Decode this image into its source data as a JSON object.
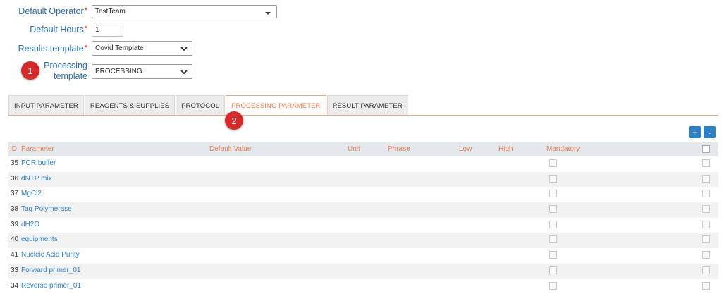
{
  "form": {
    "operator": {
      "label": "Default Operator",
      "value": "TestTeam"
    },
    "hours": {
      "label": "Default Hours",
      "value": "1"
    },
    "results_template": {
      "label": "Results template",
      "value": "Covid Template"
    },
    "processing_template": {
      "label_line1": "Processing",
      "label_line2": "template",
      "value": "PROCESSING"
    },
    "required_mark": "*"
  },
  "badges": {
    "one": "1",
    "two": "2"
  },
  "tabs": [
    {
      "label": "INPUT PARAMETER",
      "active": false
    },
    {
      "label": "REAGENTS & SUPPLIES",
      "active": false
    },
    {
      "label": "PROTOCOL",
      "active": false
    },
    {
      "label": "PROCESSING PARAMETER",
      "active": true
    },
    {
      "label": "RESULT PARAMETER",
      "active": false
    }
  ],
  "actions": {
    "add": "+",
    "remove": "-"
  },
  "table": {
    "headers": {
      "id": "ID",
      "parameter": "Parameter",
      "default_value": "Default Value",
      "unit": "Unit",
      "phrase": "Phrase",
      "low": "Low",
      "high": "High",
      "mandatory": "Mandatory"
    },
    "rows": [
      {
        "id": "35",
        "name": "PCR buffer"
      },
      {
        "id": "36",
        "name": "dNTP mix"
      },
      {
        "id": "37",
        "name": "MgCl2"
      },
      {
        "id": "38",
        "name": "Taq Polymerase"
      },
      {
        "id": "39",
        "name": "dH2O"
      },
      {
        "id": "40",
        "name": "equipments"
      },
      {
        "id": "41",
        "name": "Nucleic Acid Purity"
      },
      {
        "id": "33",
        "name": "Forward primer_01"
      },
      {
        "id": "34",
        "name": "Reverse primer_01"
      }
    ]
  },
  "colors": {
    "label_blue": "#2d6aa8",
    "accent_orange": "#e87b4a",
    "button_blue": "#2f7fc6",
    "badge_red": "#d42a2a"
  }
}
